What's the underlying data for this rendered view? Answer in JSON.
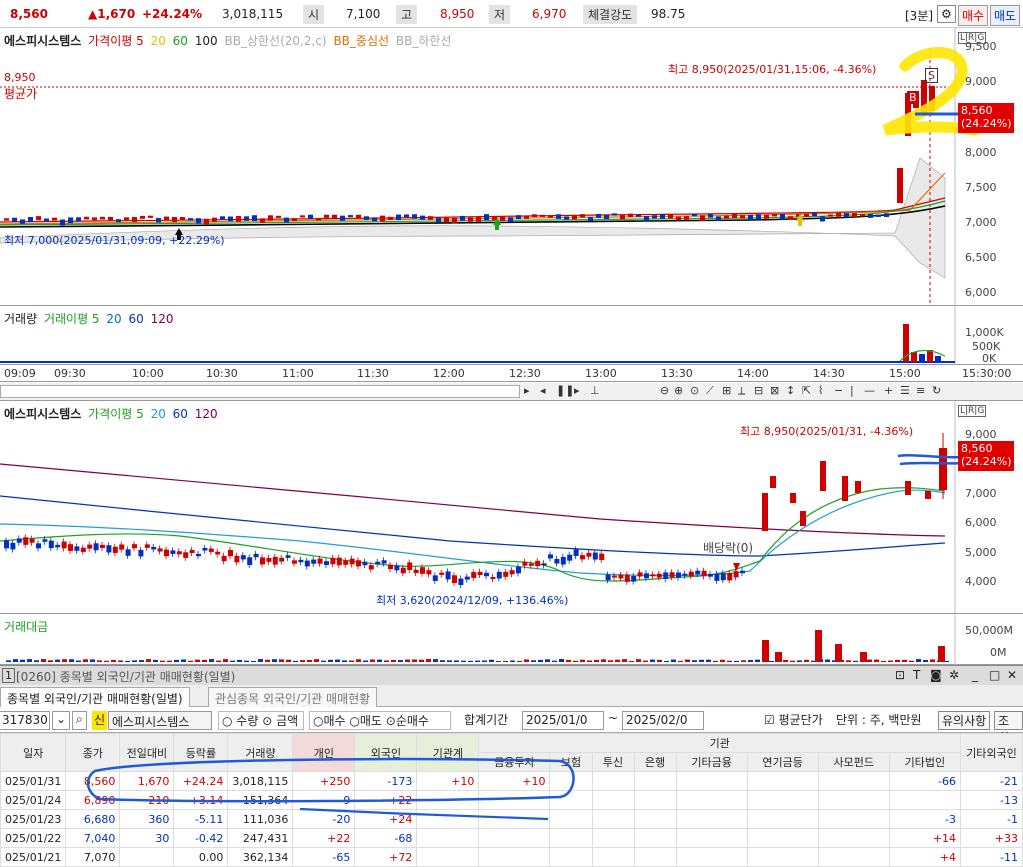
{
  "topbar": {
    "price": "8,560",
    "change": "▲1,670",
    "rate": "+24.24%",
    "volume": "3,018,115",
    "open_label": "시",
    "open": "7,100",
    "high_label": "고",
    "high": "8,950",
    "low_label": "저",
    "low": "6,970",
    "strength_label": "체결강도",
    "strength": "98.75",
    "interval": "[3분]",
    "buy_label": "매수",
    "sell_label": "매도"
  },
  "intraday": {
    "legend_name": "에스피시스템스",
    "legend_items": [
      "가격이평 5",
      "20",
      "60",
      "100",
      "BB_상한선(20,2,c)",
      "BB_중심선",
      "BB_하한선"
    ],
    "avg_price_label": "평균가",
    "avg_price_value": "8,950",
    "max_note": "최고 8,950(2025/01/31,15:06, -4.36%)",
    "min_note": "최저 7,000(2025/01/31,09:09, +22.29%)",
    "price_tag": "8,560",
    "price_tag_pct": "(24.24%)",
    "y_ticks": [
      "9,500",
      "9,000",
      "8,500",
      "8,000",
      "7,500",
      "7,000",
      "6,500",
      "6,000"
    ],
    "marker_b": "B",
    "marker_s": "S",
    "handwriting": "2"
  },
  "intraday_volume": {
    "legend_items": [
      "거래량",
      "거래이평 5",
      "20",
      "60",
      "120"
    ],
    "y_ticks": [
      "1,000K",
      "500K",
      "0K"
    ]
  },
  "time_axis": [
    "09:09",
    "09:30",
    "10:00",
    "10:30",
    "11:00",
    "11:30",
    "12:00",
    "12:30",
    "13:00",
    "13:30",
    "14:00",
    "14:30",
    "15:00",
    "15:30:00"
  ],
  "daily": {
    "legend_name": "에스피시스템스",
    "legend_items": [
      "가격이평 5",
      "20",
      "60",
      "120"
    ],
    "max_note": "최고 8,950(2025/01/31, -4.36%)",
    "min_note": "최저 3,620(2024/12/09, +136.46%)",
    "dividend_note": "배당락(0)",
    "price_tag": "8,560",
    "price_tag_pct": "(24.24%)",
    "y_ticks": [
      "9,000",
      "8,000",
      "7,000",
      "6,000",
      "5,000",
      "4,000"
    ]
  },
  "daily_volume": {
    "legend": "거래대금",
    "y_ticks": [
      "50,000M",
      "0M"
    ]
  },
  "panel": {
    "title": "[0260] 종목별 외국인/기관 매매현황(일별)",
    "tabs": [
      "종목별 외국인/기관 매매현황(일별)",
      "관심종목 외국인/기관 매매현황"
    ]
  },
  "form": {
    "code": "317830",
    "badge": "신",
    "name": "에스피시스템스",
    "radio_qty": "수량",
    "radio_amt": "금액",
    "radio_buy": "매수",
    "radio_sell": "매도",
    "radio_net": "순매수",
    "period_label": "합계기간",
    "date_from": "2025/01/0",
    "date_to": "2025/02/0",
    "avg_check": "평균단가",
    "unit": "단위 : 주, 백만원",
    "notice_btn": "유의사항",
    "query_btn": "조회"
  },
  "table": {
    "headers": [
      "일자",
      "종가",
      "전일대비",
      "등락률",
      "거래량",
      "개인",
      "외국인",
      "기관계",
      "금융투자",
      "보험",
      "투신",
      "은행",
      "기타금융",
      "연기금등",
      "사모펀드",
      "기타법인",
      "기타외국인"
    ],
    "institution_group": "기관",
    "rows": [
      [
        "025/01/31",
        "8,560",
        "1,670",
        "+24.24",
        "3,018,115",
        "+250",
        "-173",
        "+10",
        "+10",
        "",
        "",
        "",
        "",
        "",
        "",
        "-66",
        "-21"
      ],
      [
        "025/01/24",
        "6,890",
        "210",
        "+3.14",
        "151,364",
        "-9",
        "+22",
        "",
        "",
        "",
        "",
        "",
        "",
        "",
        "",
        "",
        "-13"
      ],
      [
        "025/01/23",
        "6,680",
        "360",
        "-5.11",
        "111,036",
        "-20",
        "+24",
        "",
        "",
        "",
        "",
        "",
        "",
        "",
        "",
        "-3",
        "-1"
      ],
      [
        "025/01/22",
        "7,040",
        "30",
        "-0.42",
        "247,431",
        "+22",
        "-68",
        "",
        "",
        "",
        "",
        "",
        "",
        "",
        "",
        "+14",
        "+33"
      ],
      [
        "025/01/21",
        "7,070",
        "",
        "0.00",
        "362,134",
        "-65",
        "+72",
        "",
        "",
        "",
        "",
        "",
        "",
        "",
        "",
        "+4",
        "-11"
      ]
    ]
  },
  "colors": {
    "up": "#d00000",
    "down": "#0030c0",
    "highlight": "#ffe600",
    "pen": "#1f5bd8"
  }
}
